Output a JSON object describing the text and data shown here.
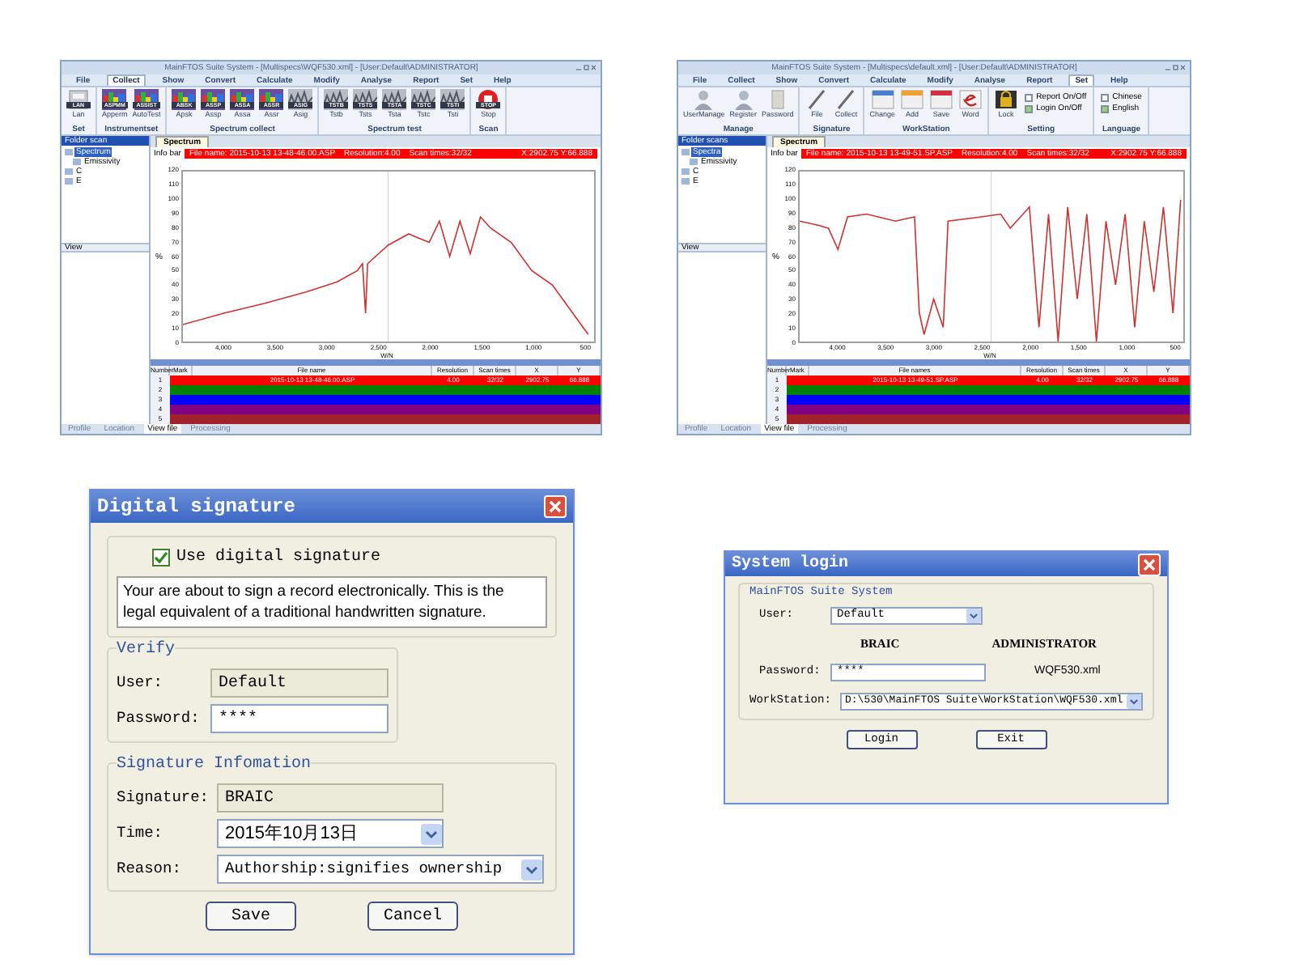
{
  "windows": [
    {
      "title": "MainFTOS Suite System - [Multispecs\\WQF530.xml] - [User:Default\\ADMINISTRATOR]",
      "menu": [
        {
          "label": "File",
          "selected": false
        },
        {
          "label": "Collect",
          "selected": true
        },
        {
          "label": "Show",
          "selected": false
        },
        {
          "label": "Convert",
          "selected": false
        },
        {
          "label": "Calculate",
          "selected": false
        },
        {
          "label": "Modify",
          "selected": false
        },
        {
          "label": "Analyse",
          "selected": false
        },
        {
          "label": "Report",
          "selected": false
        },
        {
          "label": "Set",
          "selected": false
        },
        {
          "label": "Help",
          "selected": false
        }
      ],
      "ribbon": [
        {
          "label": "Set",
          "items": [
            {
              "kind": "lan",
              "caption": "LAN",
              "label": "Lan"
            }
          ]
        },
        {
          "label": "Instrumentset",
          "items": [
            {
              "kind": "chart",
              "caption": "ASPMM",
              "label": "Apperm"
            },
            {
              "kind": "chart",
              "caption": "ASSIST",
              "label": "AutoTest"
            }
          ]
        },
        {
          "label": "Spectrum collect",
          "items": [
            {
              "kind": "chart",
              "caption": "ABSK",
              "label": "Apsk"
            },
            {
              "kind": "chart",
              "caption": "ASSP",
              "label": "Assp"
            },
            {
              "kind": "chart",
              "caption": "ASSA",
              "label": "Assa"
            },
            {
              "kind": "chart",
              "caption": "ASSR",
              "label": "Assr"
            },
            {
              "kind": "scan",
              "caption": "ASIG",
              "label": "Asig"
            }
          ]
        },
        {
          "label": "Spectrum test",
          "items": [
            {
              "kind": "scan",
              "caption": "TSTB",
              "label": "Tstb"
            },
            {
              "kind": "scan",
              "caption": "TSTS",
              "label": "Tsts"
            },
            {
              "kind": "scan",
              "caption": "TSTA",
              "label": "Tsta"
            },
            {
              "kind": "scan",
              "caption": "TSTC",
              "label": "Tstc"
            },
            {
              "kind": "scan",
              "caption": "TSTI",
              "label": "Tsti"
            }
          ]
        },
        {
          "label": "Scan",
          "items": [
            {
              "kind": "stop",
              "caption": "STOP",
              "label": "Stop"
            }
          ]
        }
      ],
      "tree": {
        "header": "Folder scan",
        "items": [
          {
            "label": "Spectrum",
            "selected": true,
            "children": [
              {
                "label": "Emissivity",
                "selected": false
              }
            ]
          },
          {
            "label": "C",
            "selected": false
          },
          {
            "label": "E",
            "selected": false
          }
        ]
      },
      "view_panel": "View",
      "bottom_tabs": [
        {
          "label": "Profile",
          "selected": false
        },
        {
          "label": "Location",
          "selected": false
        },
        {
          "label": "View file",
          "selected": true
        },
        {
          "label": "Processing",
          "selected": false
        }
      ],
      "spectrum": {
        "tab": "Spectrum",
        "info_label": "Info bar",
        "file_info": "File name: 2015-10-13 13-48-46.00.ASP    Resolution:4.00    Scan times:32/32",
        "cursor": "X:2902.75 Y:66.888",
        "chart_data": {
          "type": "line",
          "xlabel": "W/N",
          "ylabel": "%",
          "xlim": [
            4400,
            400
          ],
          "ylim": [
            0,
            120
          ],
          "ref_lines": [
            {
              "axis": "x",
              "value": 2400
            }
          ],
          "x": [
            4400,
            4000,
            3600,
            3200,
            2900,
            2700,
            2650,
            2620,
            2600,
            2400,
            2200,
            2000,
            1900,
            1800,
            1700,
            1600,
            1500,
            1400,
            1200,
            1000,
            800,
            600,
            450
          ],
          "series": [
            {
              "color": "#d03030",
              "values": [
                12,
                20,
                27,
                35,
                42,
                50,
                55,
                20,
                55,
                68,
                76,
                70,
                85,
                60,
                85,
                62,
                88,
                80,
                70,
                50,
                40,
                20,
                5
              ]
            }
          ],
          "yticks": [
            120,
            110,
            100,
            90,
            80,
            70,
            60,
            50,
            40,
            30,
            20,
            10,
            0
          ],
          "xticks": [
            {
              "value": 4000,
              "label": "4,000"
            },
            {
              "value": 3500,
              "label": "3,500"
            },
            {
              "value": 3000,
              "label": "3,000"
            },
            {
              "value": 2500,
              "label": "2,500"
            },
            {
              "value": 2000,
              "label": "2,000"
            },
            {
              "value": 1500,
              "label": "1,500"
            },
            {
              "value": 1000,
              "label": "1,000"
            },
            {
              "value": 500,
              "label": "500"
            }
          ]
        }
      },
      "table": {
        "columns": [
          "Number",
          "Mark",
          "File name",
          "Resolution",
          "Scan times",
          "X",
          "Y"
        ],
        "rows": [
          {
            "color": "#ff0000",
            "cells": [
              "1",
              "",
              "2015-10-13 13-48-46.00.ASP",
              "4.00",
              "32/32",
              "2902.75",
              "66.888"
            ]
          },
          {
            "color": "#008000",
            "cells": [
              "2"
            ]
          },
          {
            "color": "#0000ff",
            "cells": [
              "3"
            ]
          },
          {
            "color": "#800080",
            "cells": [
              "4"
            ]
          },
          {
            "color": "#a0222a",
            "cells": [
              "5"
            ]
          }
        ]
      }
    },
    {
      "title": "MainFTOS Suite System - [Multispecs\\default.xml] - [User:Default\\ADMINISTRATOR]",
      "menu": [
        {
          "label": "File",
          "selected": false
        },
        {
          "label": "Collect",
          "selected": false
        },
        {
          "label": "Show",
          "selected": false
        },
        {
          "label": "Convert",
          "selected": false
        },
        {
          "label": "Calculate",
          "selected": false
        },
        {
          "label": "Modify",
          "selected": false
        },
        {
          "label": "Analyse",
          "selected": false
        },
        {
          "label": "Report",
          "selected": false
        },
        {
          "label": "Set",
          "selected": true
        },
        {
          "label": "Help",
          "selected": false
        }
      ],
      "ribbon": [
        {
          "label": "Manage",
          "items": [
            {
              "kind": "user",
              "label": "UserManage"
            },
            {
              "kind": "user",
              "label": "Register"
            },
            {
              "kind": "doc",
              "label": "Password"
            }
          ]
        },
        {
          "label": "Signature",
          "items": [
            {
              "kind": "pen",
              "label": "File"
            },
            {
              "kind": "pen",
              "label": "Collect"
            }
          ]
        },
        {
          "label": "WorkStation",
          "items": [
            {
              "kind": "window",
              "color": "#4a7fd0",
              "label": "Change"
            },
            {
              "kind": "window",
              "color": "#f0a030",
              "label": "Add"
            },
            {
              "kind": "window",
              "color": "#d03040",
              "label": "Save"
            },
            {
              "kind": "word",
              "label": "Word"
            }
          ]
        },
        {
          "label": "Setting",
          "items": [
            {
              "kind": "lock",
              "label": "Lock"
            },
            {
              "kind": "check",
              "label": "Report On/Off",
              "checked": false
            },
            {
              "kind": "check",
              "label": "Login On/Off",
              "checked": true
            }
          ]
        },
        {
          "label": "Language",
          "items": [
            {
              "kind": "check",
              "label": "Chinese",
              "checked": false
            },
            {
              "kind": "check",
              "label": "English",
              "checked": true
            }
          ]
        }
      ],
      "tree": {
        "header": "Folder scans",
        "items": [
          {
            "label": "Spectra",
            "selected": true,
            "children": [
              {
                "label": "Emissivity",
                "selected": false
              }
            ]
          },
          {
            "label": "C",
            "selected": false
          },
          {
            "label": "E",
            "selected": false
          }
        ]
      },
      "view_panel": "View",
      "bottom_tabs": [
        {
          "label": "Profile",
          "selected": false
        },
        {
          "label": "Location",
          "selected": false
        },
        {
          "label": "View file",
          "selected": true
        },
        {
          "label": "Processing",
          "selected": false
        }
      ],
      "spectrum": {
        "tab": "Spectrum",
        "info_label": "Info bar",
        "file_info": "File name: 2015-10-13 13-49-51.SP.ASP    Resolution:4.00    Scan times:32/32",
        "cursor": "X:2902.75 Y:66.888",
        "chart_data": {
          "type": "line",
          "xlabel": "W/N",
          "ylabel": "%",
          "xlim": [
            4400,
            400
          ],
          "ylim": [
            0,
            120
          ],
          "ref_lines": [
            {
              "axis": "x",
              "value": 2400
            }
          ],
          "x": [
            4400,
            4200,
            4100,
            4000,
            3900,
            3700,
            3400,
            3200,
            3150,
            3100,
            3000,
            2900,
            2850,
            2500,
            2300,
            2200,
            2000,
            1900,
            1800,
            1700,
            1600,
            1500,
            1400,
            1300,
            1200,
            1100,
            1000,
            900,
            800,
            700,
            600,
            500,
            420
          ],
          "series": [
            {
              "color": "#d03030",
              "values": [
                85,
                82,
                80,
                65,
                88,
                90,
                85,
                88,
                20,
                5,
                30,
                10,
                85,
                88,
                90,
                80,
                95,
                10,
                90,
                0,
                95,
                30,
                90,
                0,
                85,
                40,
                90,
                10,
                85,
                35,
                95,
                20,
                100
              ]
            }
          ],
          "yticks": [
            120,
            110,
            100,
            90,
            80,
            70,
            60,
            50,
            40,
            30,
            20,
            10,
            0
          ],
          "xticks": [
            {
              "value": 4000,
              "label": "4,000"
            },
            {
              "value": 3500,
              "label": "3,500"
            },
            {
              "value": 3000,
              "label": "3,000"
            },
            {
              "value": 2500,
              "label": "2,500"
            },
            {
              "value": 2000,
              "label": "2,000"
            },
            {
              "value": 1500,
              "label": "1,500"
            },
            {
              "value": 1000,
              "label": "1,000"
            },
            {
              "value": 500,
              "label": "500"
            }
          ]
        }
      },
      "table": {
        "columns": [
          "Number",
          "Mark",
          "File names",
          "Resolution",
          "Scan times",
          "X",
          "Y"
        ],
        "rows": [
          {
            "color": "#ff0000",
            "cells": [
              "1",
              "",
              "2015-10-13 13-49-51.SP.ASP",
              "4.00",
              "32/32",
              "2902.75",
              "66.888"
            ]
          },
          {
            "color": "#008000",
            "cells": [
              "2"
            ]
          },
          {
            "color": "#0000ff",
            "cells": [
              "3"
            ]
          },
          {
            "color": "#800080",
            "cells": [
              "4"
            ]
          },
          {
            "color": "#a0222a",
            "cells": [
              "5"
            ]
          }
        ]
      }
    }
  ],
  "signature_dialog": {
    "title": "Digital signature",
    "use_signature": {
      "label": "Use digital signature",
      "checked": true
    },
    "notice": "Your are about to sign a record electronically. This is the legal equivalent of a traditional handwritten signature.",
    "verify": {
      "legend": "Verify",
      "user_label": "User:",
      "user": "Default",
      "password_label": "Password:",
      "password": "****"
    },
    "info": {
      "legend": "Signature Infomation",
      "signature_label": "Signature:",
      "signature": "BRAIC",
      "time_label": "Time:",
      "time": "2015年10月13日",
      "reason_label": "Reason:",
      "reason": "Authorship:signifies ownership"
    },
    "buttons": [
      "Save",
      "Cancel"
    ]
  },
  "login_dialog": {
    "title": "System login",
    "legend": "MainFTOS Suite System",
    "user_label": "User:",
    "user": "Default",
    "company": "BRAIC",
    "role": "ADMINISTRATOR",
    "password_label": "Password:",
    "password": "****",
    "config": "WQF530.xml",
    "workstation_label": "WorkStation:",
    "workstation": "D:\\530\\MainFTOS Suite\\WorkStation\\WQF530.xml",
    "buttons": [
      "Login",
      "Exit"
    ]
  }
}
